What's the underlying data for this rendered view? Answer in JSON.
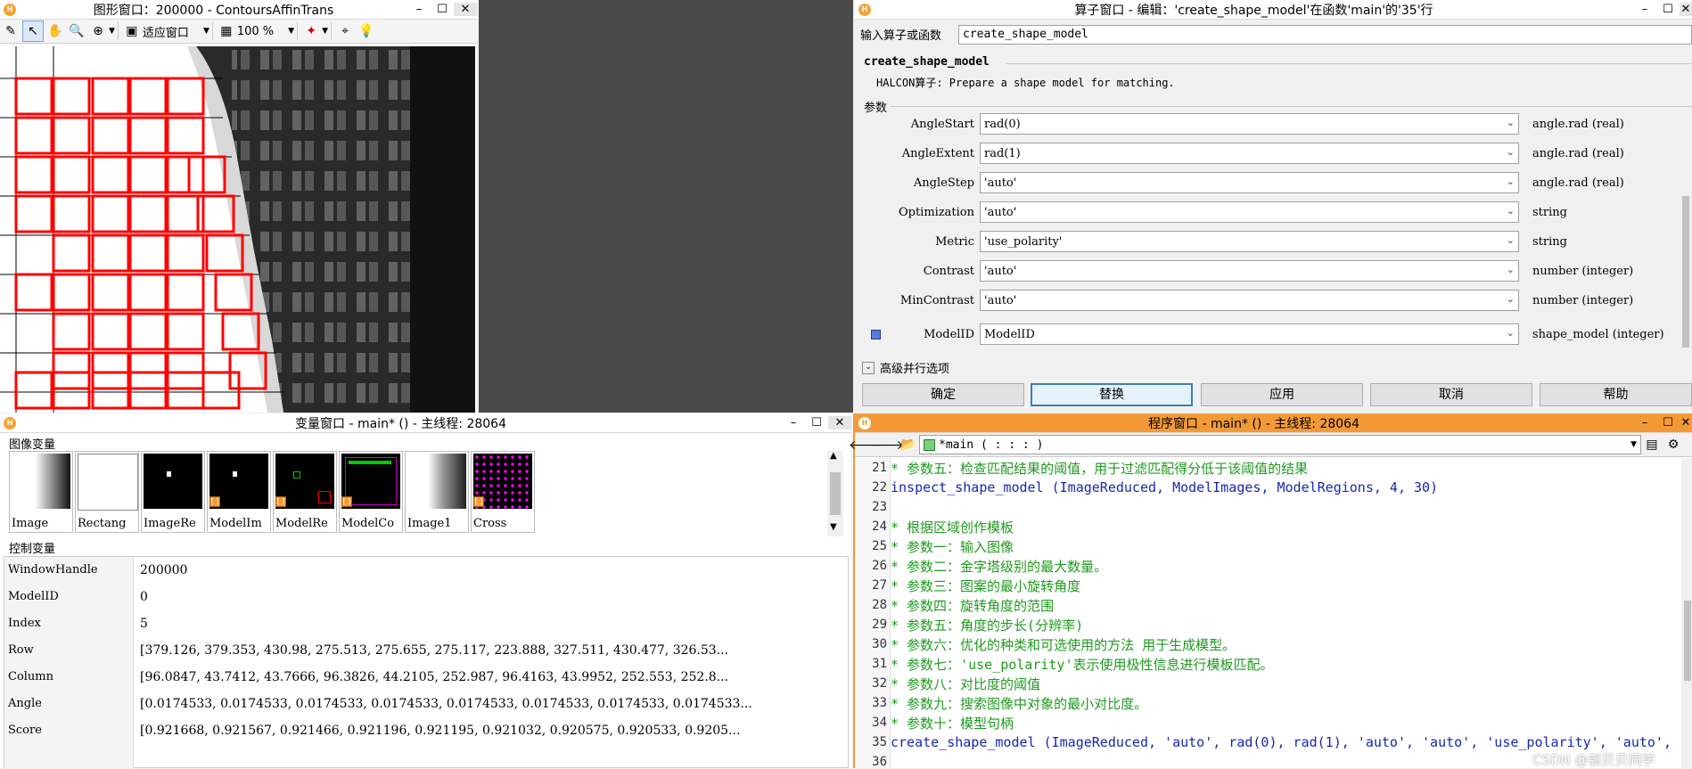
{
  "graphics_window": {
    "title": "图形窗口：200000 - ContoursAffinTrans",
    "fit_label": "适应窗口",
    "zoom_label": "100 %"
  },
  "operator_window": {
    "title": "算子窗口 - 编辑：'create_shape_model'在函数'main'的'35'行",
    "input_label": "输入算子或函数",
    "input_value": "create_shape_model",
    "op_name": "create_shape_model",
    "op_desc": "HALCON算子: Prepare a shape model for matching.",
    "params_label": "参数",
    "params": [
      {
        "name": "AngleStart",
        "value": "rad(0)",
        "type": "angle.rad (real)"
      },
      {
        "name": "AngleExtent",
        "value": "rad(1)",
        "type": "angle.rad (real)"
      },
      {
        "name": "AngleStep",
        "value": "'auto'",
        "type": "angle.rad (real)"
      },
      {
        "name": "Optimization",
        "value": "'auto'",
        "type": "string"
      },
      {
        "name": "Metric",
        "value": "'use_polarity'",
        "type": "string"
      },
      {
        "name": "Contrast",
        "value": "'auto'",
        "type": "number (integer)"
      },
      {
        "name": "MinContrast",
        "value": "'auto'",
        "type": "number (integer)"
      },
      {
        "name": "ModelID",
        "value": "ModelID",
        "type": "shape_model (integer)"
      }
    ],
    "advanced_label": "高级并行选项",
    "buttons": {
      "ok": "确定",
      "replace": "替换",
      "apply": "应用",
      "cancel": "取消",
      "help": "帮助"
    }
  },
  "variable_window": {
    "title": "变量窗口 - main* () - 主线程: 28064",
    "image_vars_label": "图像变量",
    "thumbs": [
      "Image",
      "Rectang",
      "ImageRe",
      "ModelIm",
      "ModelRe",
      "ModelCo",
      "Image1",
      "Cross"
    ],
    "control_vars_label": "控制变量",
    "controls": [
      {
        "name": "WindowHandle",
        "value": "200000"
      },
      {
        "name": "ModelID",
        "value": "0"
      },
      {
        "name": "Index",
        "value": "5"
      },
      {
        "name": "Row",
        "value": "[379.126, 379.353, 430.98, 275.513, 275.655, 275.117, 223.888, 327.511, 430.477, 326.53..."
      },
      {
        "name": "Column",
        "value": "[96.0847, 43.7412, 43.7666, 96.3826, 44.2105, 252.987, 96.4163, 43.9952, 252.553, 252.8..."
      },
      {
        "name": "Angle",
        "value": "[0.0174533, 0.0174533, 0.0174533, 0.0174533, 0.0174533, 0.0174533, 0.0174533, 0.0174533..."
      },
      {
        "name": "Score",
        "value": "[0.921668, 0.921567, 0.921466, 0.921196, 0.921195, 0.921032, 0.920575, 0.920533, 0.9205..."
      }
    ]
  },
  "program_window": {
    "title": "程序窗口 - main* () - 主线程: 28064",
    "proc_selector": "*main ( : : : )",
    "lines": [
      {
        "n": "21",
        "text": "* 参数五：检查匹配结果的阈值，用于过滤匹配得分低于该阈值的结果",
        "kind": "cmt"
      },
      {
        "n": "22",
        "text": "inspect_shape_model (ImageReduced, ModelImages, ModelRegions, 4, 30)",
        "kind": "code"
      },
      {
        "n": "23",
        "text": "",
        "kind": "code"
      },
      {
        "n": "24",
        "text": "* 根据区域创作模板",
        "kind": "cmt"
      },
      {
        "n": "25",
        "text": "* 参数一：输入图像",
        "kind": "cmt"
      },
      {
        "n": "26",
        "text": "* 参数二：金字塔级别的最大数量。",
        "kind": "cmt"
      },
      {
        "n": "27",
        "text": "* 参数三：图案的最小旋转角度",
        "kind": "cmt"
      },
      {
        "n": "28",
        "text": "* 参数四：旋转角度的范围",
        "kind": "cmt"
      },
      {
        "n": "29",
        "text": "* 参数五：角度的步长(分辨率)",
        "kind": "cmt"
      },
      {
        "n": "30",
        "text": "* 参数六：优化的种类和可选使用的方法 用于生成模型。",
        "kind": "cmt"
      },
      {
        "n": "31",
        "text": "* 参数七：'use_polarity'表示使用极性信息进行模板匹配。",
        "kind": "cmt"
      },
      {
        "n": "32",
        "text": "* 参数八：对比度的阈值",
        "kind": "cmt"
      },
      {
        "n": "33",
        "text": "* 参数九：搜索图像中对象的最小对比度。",
        "kind": "cmt"
      },
      {
        "n": "34",
        "text": "* 参数十：模型句柄",
        "kind": "cmt"
      },
      {
        "n": "35",
        "text": "create_shape_model (ImageReduced, 'auto', rad(0), rad(1), 'auto', 'auto', 'use_polarity', 'auto',",
        "kind": "code"
      },
      {
        "n": "36",
        "text": "",
        "kind": "code"
      }
    ],
    "watermark": "CSDN @郭贝贝同学"
  }
}
